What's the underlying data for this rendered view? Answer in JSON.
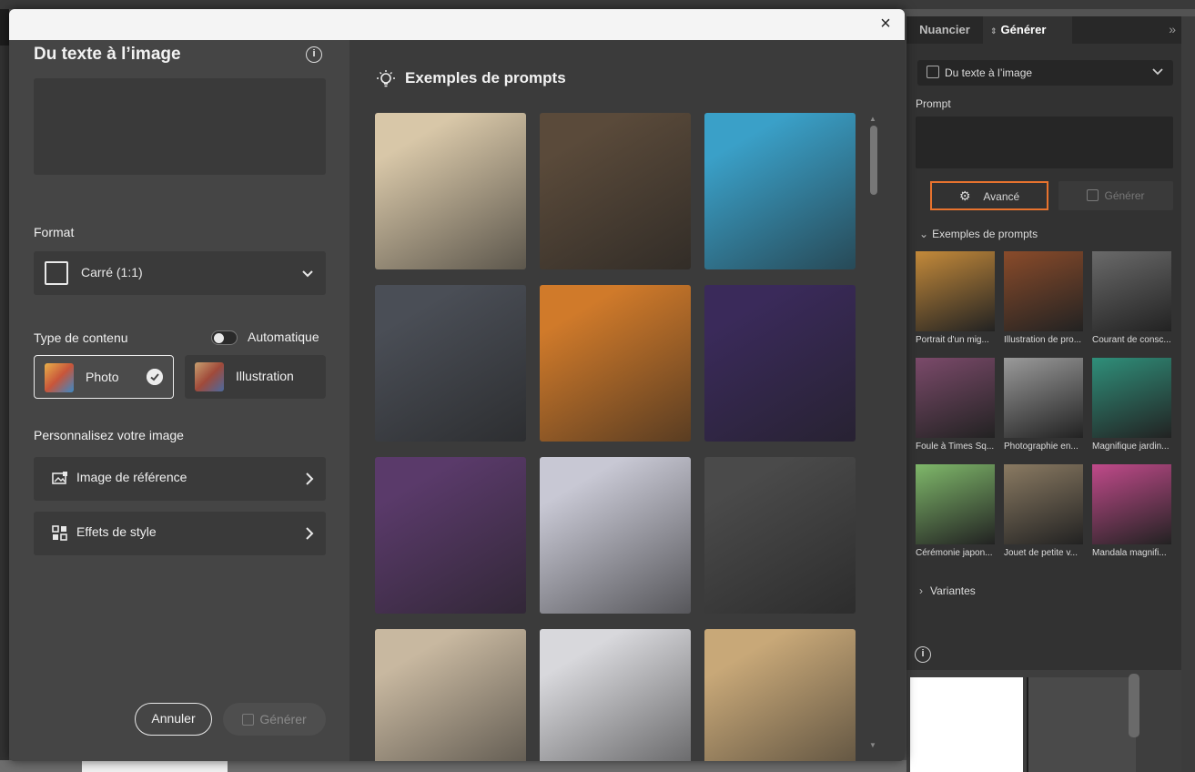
{
  "dialog": {
    "title": "Du texte à l’image",
    "format_label": "Format",
    "format_value": "Carré (1:1)",
    "content_type_label": "Type de contenu",
    "auto_label": "Automatique",
    "photo_label": "Photo",
    "illustration_label": "Illustration",
    "personalize_label": "Personnalisez votre image",
    "reference_image_label": "Image de référence",
    "style_effects_label": "Effets de style",
    "cancel_label": "Annuler",
    "generate_label": "Générer",
    "examples_title": "Exemples de prompts",
    "close_symbol": "×"
  },
  "panel": {
    "tabs": [
      "Nuancier",
      "Générer"
    ],
    "mode_value": "Du texte à l’image",
    "prompt_label": "Prompt",
    "advanced_label": "Avancé",
    "generate_label": "Générer",
    "examples_label": "Exemples de prompts",
    "variants_label": "Variantes",
    "thumbs": [
      {
        "caption": "Portrait d'un mig...",
        "color": "#c48a3a"
      },
      {
        "caption": "Illustration de pro...",
        "color": "#8a4b2a"
      },
      {
        "caption": "Courant de consc...",
        "color": "#6a6a6a"
      },
      {
        "caption": "Foule à Times Sq...",
        "color": "#7b4a6a"
      },
      {
        "caption": "Photographie en...",
        "color": "#9a9a9a"
      },
      {
        "caption": "Magnifique jardin...",
        "color": "#2f8f7a"
      },
      {
        "caption": "Cérémonie japon...",
        "color": "#7fb86a"
      },
      {
        "caption": "Jouet de petite v...",
        "color": "#8a7a62"
      },
      {
        "caption": "Mandala magnifi...",
        "color": "#c04a8a"
      }
    ]
  },
  "examples": [
    {
      "name": "example-notebook-vase",
      "color": "#d8c7a8"
    },
    {
      "name": "example-tomato-soup",
      "color": "#5a4a3a"
    },
    {
      "name": "example-woman-glasses-3d",
      "color": "#3aa0c8"
    },
    {
      "name": "example-soccer-player",
      "color": "#4a4e56"
    },
    {
      "name": "example-dragon",
      "color": "#d07a2a"
    },
    {
      "name": "example-waterfall",
      "color": "#3a2a5a"
    },
    {
      "name": "example-colorful-woman",
      "color": "#5a3a6a"
    },
    {
      "name": "example-watercolor-fashion",
      "color": "#c8c8d4"
    },
    {
      "name": "example-marble-table",
      "color": "#4a4a4a"
    },
    {
      "name": "example-kitchen",
      "color": "#c8b8a0"
    },
    {
      "name": "example-woman-portrait",
      "color": "#d8d8dc"
    },
    {
      "name": "example-desert-van",
      "color": "#c8a878"
    }
  ]
}
